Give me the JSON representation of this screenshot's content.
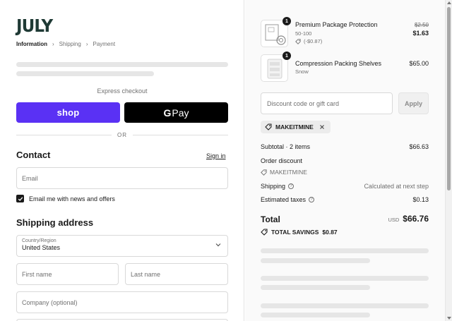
{
  "brand": {
    "logo_text": "JULY"
  },
  "breadcrumb": {
    "items": [
      "Information",
      "Shipping",
      "Payment"
    ],
    "separator": "›"
  },
  "express": {
    "label": "Express checkout",
    "shop_label": "shop",
    "gpay_g": "G",
    "gpay_label": "Pay",
    "or_label": "OR"
  },
  "contact": {
    "title": "Contact",
    "signin_label": "Sign in",
    "email_placeholder": "Email",
    "newsletter_label": "Email me with news and offers",
    "newsletter_checked": true
  },
  "shipping": {
    "title": "Shipping address",
    "country_label": "Country/Region",
    "country_value": "United States",
    "first_name_placeholder": "First name",
    "last_name_placeholder": "Last name",
    "company_placeholder": "Company (optional)"
  },
  "order": {
    "items": [
      {
        "quantity": "1",
        "title": "Premium Package Protection",
        "variant": "50-100",
        "discount": "(-$0.87)",
        "original_price": "$2.50",
        "price": "$1.63",
        "icon": "package-icon"
      },
      {
        "quantity": "1",
        "title": "Compression Packing Shelves",
        "variant": "Snow",
        "price": "$65.00",
        "icon": "shelves-icon"
      }
    ],
    "discount_placeholder": "Discount code or gift card",
    "apply_label": "Apply",
    "applied_code": "MAKEITMINE",
    "subtotal_label": "Subtotal · 2 items",
    "subtotal_value": "$66.63",
    "order_discount_label": "Order discount",
    "order_discount_code": "MAKEITMINE",
    "shipping_label": "Shipping",
    "shipping_value": "Calculated at next step",
    "taxes_label": "Estimated taxes",
    "taxes_value": "$0.13",
    "total_label": "Total",
    "currency": "USD",
    "total_value": "$66.76",
    "savings_label": "TOTAL SAVINGS",
    "savings_value": "$0.87"
  },
  "colors": {
    "shop_purple": "#5a31f4",
    "gpay_black": "#000000",
    "logo_green": "#1f3a35",
    "skeleton": "#e6e6e6"
  }
}
